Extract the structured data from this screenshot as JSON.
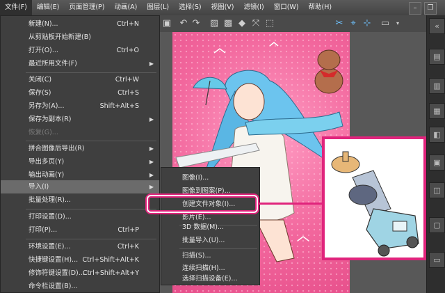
{
  "menubar": {
    "items": [
      "文件(F)",
      "编辑(E)",
      "页面管理(P)",
      "动画(A)",
      "图层(L)",
      "选择(S)",
      "视图(V)",
      "滤镜(I)",
      "窗口(W)",
      "帮助(H)"
    ]
  },
  "file_menu": {
    "items": [
      {
        "label": "新建(N)...",
        "shortcut": "Ctrl+N"
      },
      {
        "label": "从剪贴板开始新建(B)",
        "shortcut": ""
      },
      {
        "label": "打开(O)...",
        "shortcut": "Ctrl+O"
      },
      {
        "label": "最近所用文件(F)",
        "shortcut": ""
      },
      {
        "label": "关闭(C)",
        "shortcut": "Ctrl+W"
      },
      {
        "label": "保存(S)",
        "shortcut": "Ctrl+S"
      },
      {
        "label": "另存为(A)...",
        "shortcut": "Shift+Alt+S"
      },
      {
        "label": "保存为副本(R)",
        "shortcut": ""
      },
      {
        "label": "恢复(G)...",
        "shortcut": ""
      },
      {
        "label": "拼合图像后导出(R)",
        "shortcut": ""
      },
      {
        "label": "导出多页(Y)",
        "shortcut": ""
      },
      {
        "label": "输出动画(Y)",
        "shortcut": ""
      },
      {
        "label": "导入(I)",
        "shortcut": ""
      },
      {
        "label": "批量处理(R)...",
        "shortcut": ""
      },
      {
        "label": "打印设置(D)...",
        "shortcut": ""
      },
      {
        "label": "打印(P)...",
        "shortcut": "Ctrl+P"
      },
      {
        "label": "环境设置(E)...",
        "shortcut": "Ctrl+K"
      },
      {
        "label": "快捷键设置(H)...",
        "shortcut": "Ctrl+Shift+Alt+K"
      },
      {
        "label": "修饰符键设置(D)...",
        "shortcut": "Ctrl+Shift+Alt+Y"
      },
      {
        "label": "命令栏设置(B)...",
        "shortcut": ""
      }
    ]
  },
  "import_submenu": {
    "items": [
      "图像(I)...",
      "图像到图案(P)...",
      "创建文件对象(I)...",
      "影片(E)...",
      "3D 数据(M)...",
      "批量导入(U)...",
      "扫描(S)...",
      "连续扫描(H)...",
      "选择扫描设备(E)..."
    ]
  },
  "colors": {
    "accent": "#e0247c",
    "menu_bg": "#3f3f3f",
    "highlight": "#6b6b6b"
  }
}
